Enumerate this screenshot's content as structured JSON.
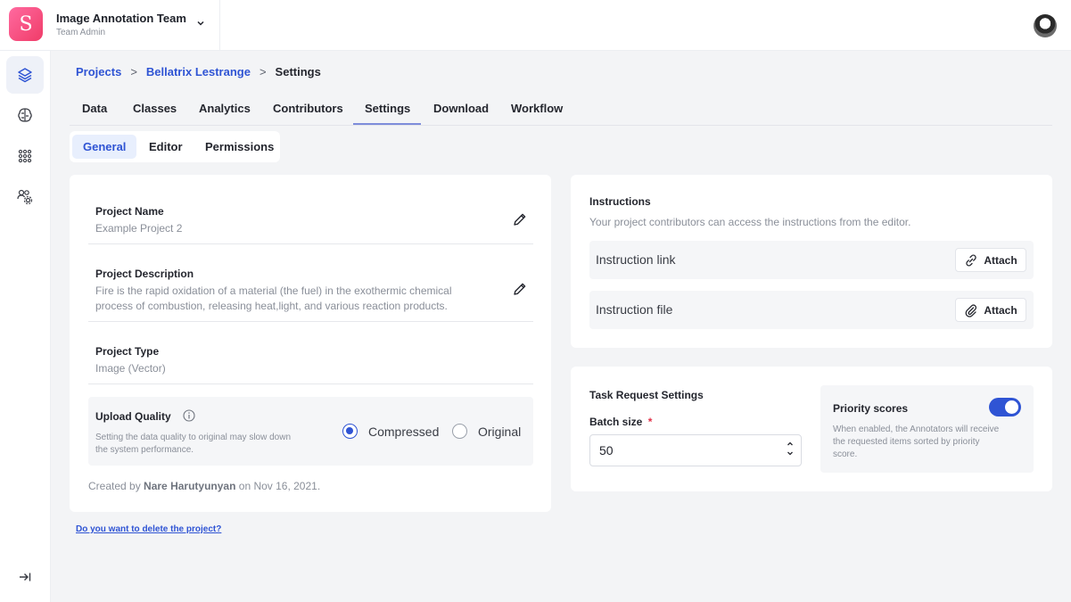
{
  "app": {
    "logo_letter": "S",
    "team_name": "Image Annotation Team",
    "team_role": "Team Admin"
  },
  "rail": {
    "items": [
      {
        "icon": "layers-icon",
        "active": true
      },
      {
        "icon": "brain-icon",
        "active": false
      },
      {
        "icon": "grid-dots-icon",
        "active": false
      },
      {
        "icon": "team-settings-icon",
        "active": false
      }
    ],
    "collapse_icon": "collapse-arrow-icon"
  },
  "breadcrumb": {
    "items": [
      "Projects",
      "Bellatrix Lestrange",
      "Settings"
    ],
    "separator": ">"
  },
  "tabs": {
    "main": [
      "Data",
      "Classes",
      "Analytics",
      "Contributors",
      "Settings",
      "Download",
      "Workflow"
    ],
    "active_main": "Settings",
    "sub": [
      "General",
      "Editor",
      "Permissions"
    ],
    "active_sub": "General"
  },
  "general": {
    "project_name_label": "Project Name",
    "project_name_value": "Example Project 2",
    "project_description_label": "Project Description",
    "project_description_line1": "Fire is the rapid oxidation of a material (the fuel) in the exothermic chemical",
    "project_description_line2": "process of combustion, releasing heat,light, and  various reaction products.",
    "project_type_label": "Project Type",
    "project_type_value": "Image (Vector)",
    "upload_quality_label": "Upload Quality",
    "upload_quality_hint_line1": "Setting the data quality to original may slow down",
    "upload_quality_hint_line2": "the system performance.",
    "upload_quality_options": [
      "Compressed",
      "Original"
    ],
    "upload_quality_selected": "Compressed",
    "created_prefix": "Created by",
    "created_by": "Nare Harutyunyan",
    "created_suffix": "on Nov 16, 2021."
  },
  "instructions": {
    "title": "Instructions",
    "subtitle": "Your project contributors can access the instructions from the editor.",
    "link_label": "Instruction link",
    "file_label": "Instruction file",
    "attach_label": "Attach"
  },
  "task_request": {
    "title": "Task Request Settings",
    "batch_size_label": "Batch size",
    "required_mark": "*",
    "batch_size_value": "50",
    "priority_label": "Priority scores",
    "priority_enabled": true,
    "priority_hint_line1": "When enabled, the Annotators will receive",
    "priority_hint_line2": "the requested items sorted by priority",
    "priority_hint_line3": "score."
  },
  "delete_link": "Do you want to delete the project?",
  "colors": {
    "accent": "#2f54d4",
    "brand_gradient_start": "#ff6aa0",
    "brand_gradient_end": "#f03c68"
  }
}
